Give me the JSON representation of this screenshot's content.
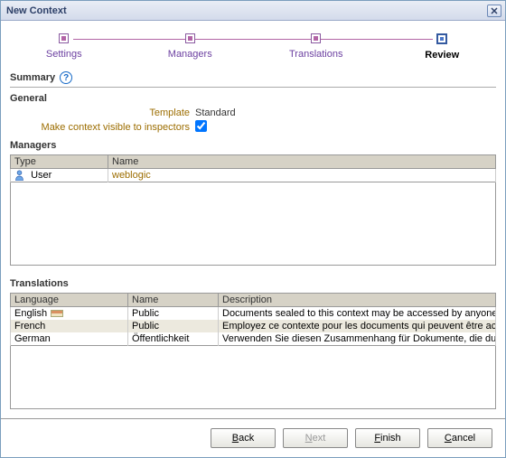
{
  "title": "New Context",
  "steps": [
    {
      "label": "Settings",
      "state": "done"
    },
    {
      "label": "Managers",
      "state": "done"
    },
    {
      "label": "Translations",
      "state": "done"
    },
    {
      "label": "Review",
      "state": "current"
    }
  ],
  "summary_label": "Summary",
  "general": {
    "heading": "General",
    "template_label": "Template",
    "template_value": "Standard",
    "visible_label": "Make context visible to inspectors",
    "visible_checked": true
  },
  "managers": {
    "heading": "Managers",
    "columns": {
      "type": "Type",
      "name": "Name"
    },
    "rows": [
      {
        "type": "User",
        "name": "weblogic"
      }
    ]
  },
  "translations": {
    "heading": "Translations",
    "columns": {
      "language": "Language",
      "name": "Name",
      "description": "Description"
    },
    "rows": [
      {
        "language": "English",
        "name": "Public",
        "description": "Documents sealed to this context may be accessed by anyone.",
        "flag": true
      },
      {
        "language": "French",
        "name": "Public",
        "description": "Employez ce contexte pour les documents qui peuvent être acc",
        "flag": false
      },
      {
        "language": "German",
        "name": "Öffentlichkeit",
        "description": "Verwenden Sie diesen Zusammenhang für Dokumente, die durch",
        "flag": false
      }
    ]
  },
  "buttons": {
    "back": "Back",
    "next": "Next",
    "finish": "Finish",
    "cancel": "Cancel"
  }
}
